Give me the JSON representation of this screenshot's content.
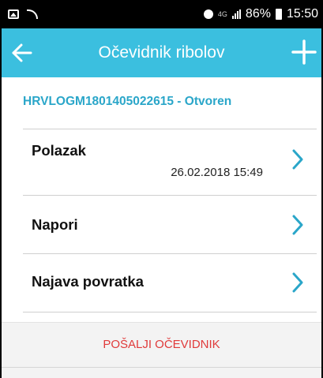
{
  "status_bar": {
    "network": "4G",
    "battery": "86%",
    "time": "15:50"
  },
  "app_bar": {
    "title": "Očevidnik ribolov",
    "back_icon": "arrow-left-icon",
    "add_icon": "plus-icon",
    "background": "#3BBFDF"
  },
  "record": {
    "id_status": "HRVLOGM1801405022615 - Otvoren",
    "color": "#2AA6C9"
  },
  "items": [
    {
      "label": "Polazak",
      "sub": "26.02.2018 15:49"
    },
    {
      "label": "Napori",
      "sub": ""
    },
    {
      "label": "Najava povratka",
      "sub": ""
    }
  ],
  "footer": {
    "send_label": "POŠALJI OČEVIDNIK",
    "color": "#E03A3A"
  }
}
